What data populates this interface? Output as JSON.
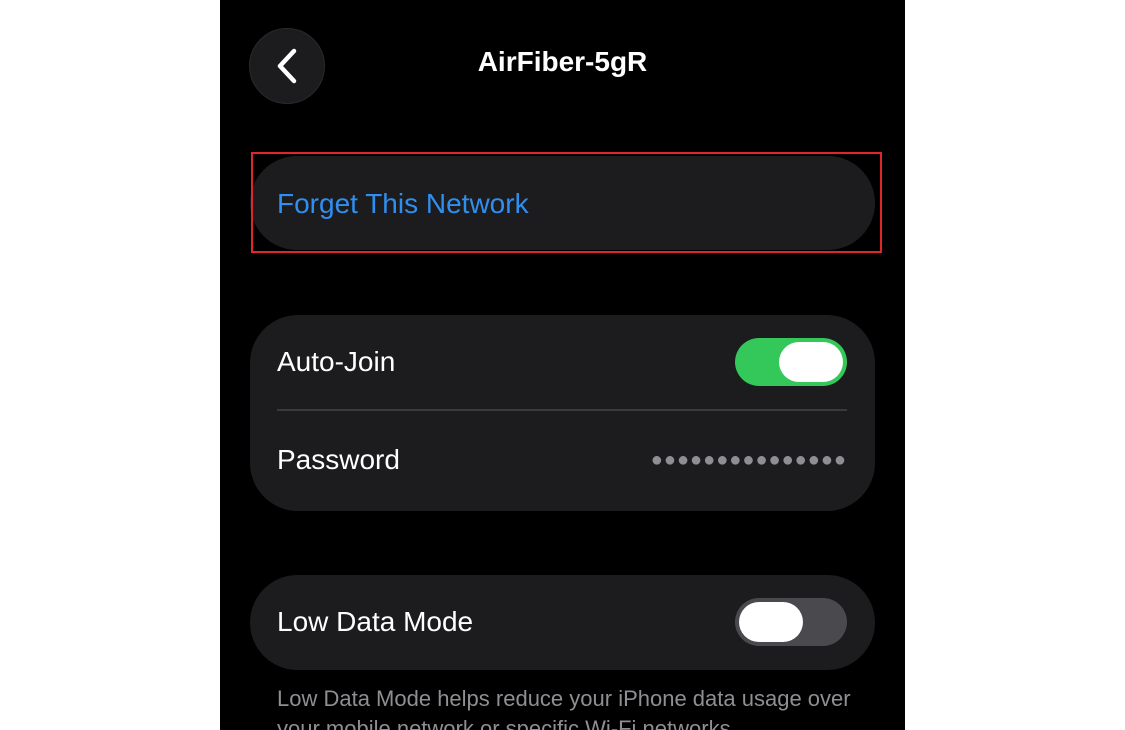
{
  "nav": {
    "title": "AirFiber-5gR"
  },
  "forget": {
    "label": "Forget This Network"
  },
  "settings": {
    "auto_join": {
      "label": "Auto-Join",
      "enabled": true
    },
    "password": {
      "label": "Password",
      "masked_value": "●●●●●●●●●●●●●●●"
    }
  },
  "low_data": {
    "label": "Low Data Mode",
    "enabled": false,
    "footnote": "Low Data Mode helps reduce your iPhone data usage over your mobile network or specific Wi-Fi networks"
  },
  "colors": {
    "toggle_on": "#34c759",
    "link": "#2f8ff0",
    "highlight": "#e0262c"
  },
  "icons": {
    "back": "chevron-left-icon"
  }
}
